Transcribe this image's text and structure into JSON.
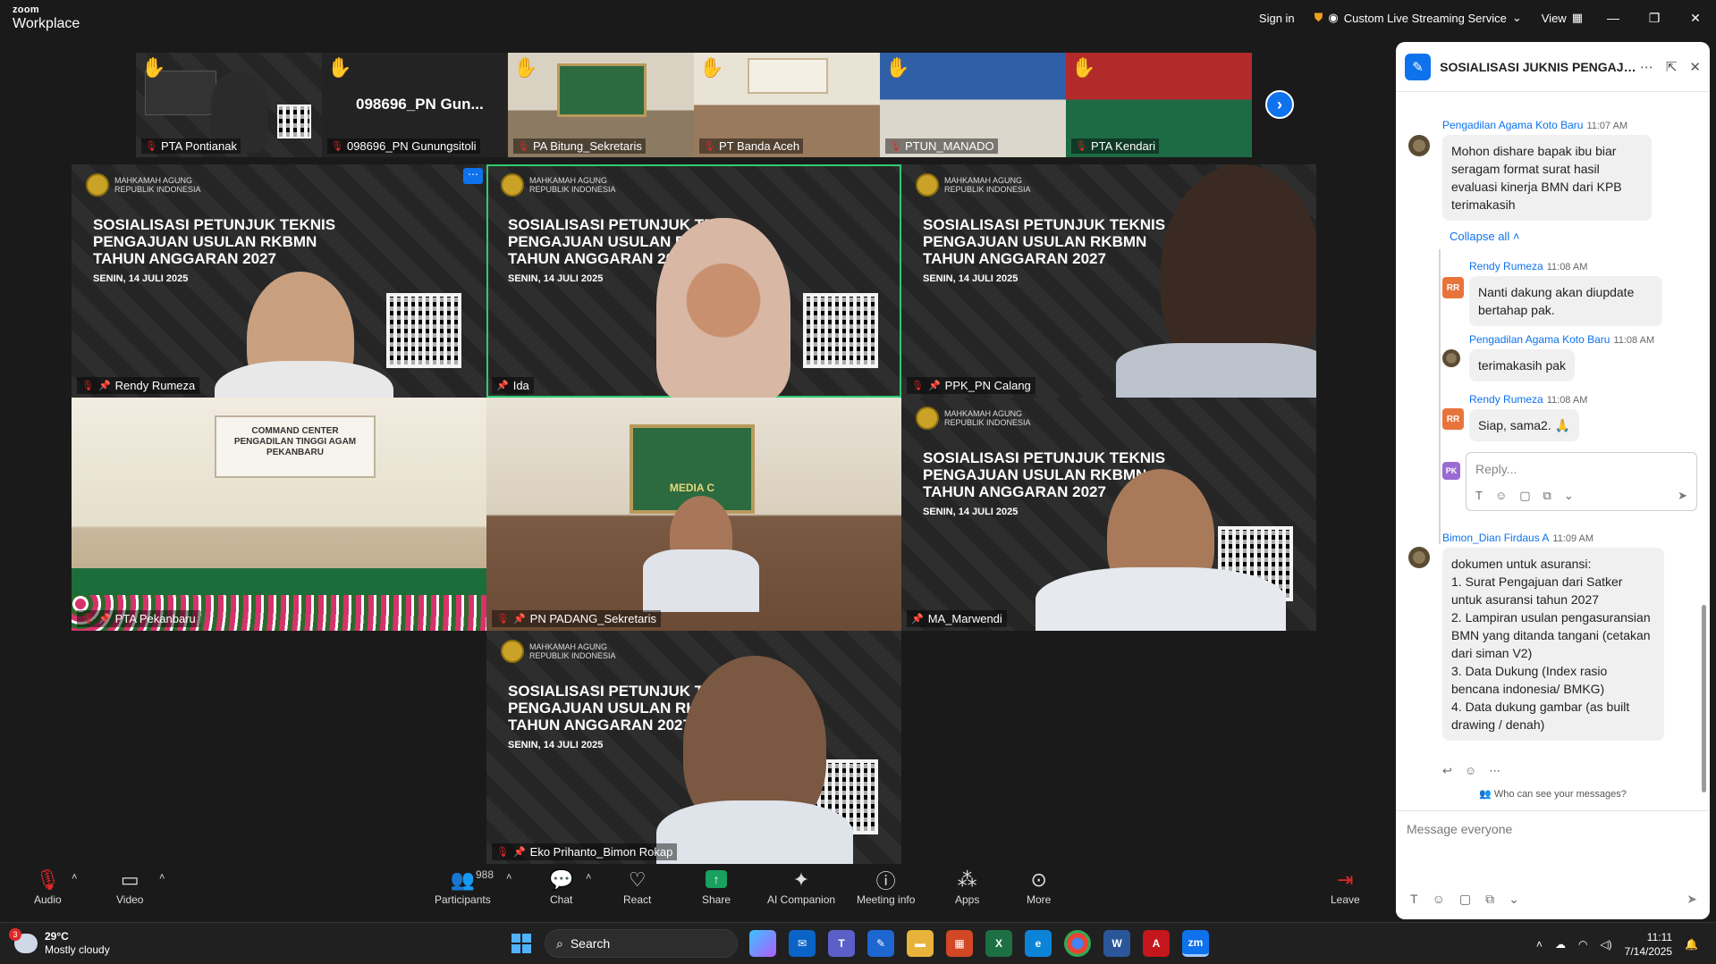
{
  "app": {
    "brand_small": "zoom",
    "brand_large": "Workplace"
  },
  "titlebar": {
    "sign_in": "Sign in",
    "stream": "Custom Live Streaming Service",
    "view": "View"
  },
  "strip": [
    {
      "label": "PTA Pontianak"
    },
    {
      "label": "098696_PN Gunungsitoli",
      "display_name": "098696_PN Gun..."
    },
    {
      "label": "PA Bitung_Sekretaris"
    },
    {
      "label": "PT Banda Aceh"
    },
    {
      "label": "PTUN_MANADO"
    },
    {
      "label": "PTA Kendari"
    }
  ],
  "slide": {
    "org_line1": "MAHKAMAH AGUNG",
    "org_line2": "REPUBLIK INDONESIA",
    "title_line1": "SOSIALISASI PETUNJUK TEKNIS",
    "title_line2": "PENGAJUAN USULAN RKBMN",
    "title_line3": "TAHUN ANGGARAN 2027",
    "title_line1_cut": "SOSIALISASI PETUNJUK TEKN",
    "title_line2_cut": "PENGAJUAN USULAN RKBM",
    "title_line3_cut": "TAHUN ANGGARAN 20",
    "date": "SENIN, 14 JULI 2025",
    "room1_banner1": "COMMAND CENTER",
    "room1_banner2": "PENGADILAN TINGGI AGAM",
    "room1_banner3": "PEKANBARU",
    "room2_banner": "MEDIA C"
  },
  "tiles": [
    {
      "name": "Rendy Rumeza"
    },
    {
      "name": "Ida"
    },
    {
      "name": "PPK_PN Calang"
    },
    {
      "name": "PTA Pekanbaru"
    },
    {
      "name": "PN PADANG_Sekretaris"
    },
    {
      "name": "MA_Marwendi"
    },
    {
      "name": "Eko Prihanto_Bimon Rokap"
    }
  ],
  "chat": {
    "title": "SOSIALISASI JUKNIS PENGAJUA...",
    "messages": [
      {
        "sender": "Pengadilan Agama Koto Baru",
        "time": "11:07 AM",
        "text": "Mohon dishare bapak ibu biar seragam format surat hasil evaluasi kinerja BMN dari KPB terimakasih"
      },
      {
        "sender": "Rendy Rumeza",
        "time": "11:08 AM",
        "initials": "RR",
        "text": "Nanti dakung akan diupdate bertahap pak."
      },
      {
        "sender": "Pengadilan Agama Koto Baru",
        "time": "11:08 AM",
        "text": "terimakasih pak"
      },
      {
        "sender": "Rendy Rumeza",
        "time": "11:08 AM",
        "initials": "RR",
        "text": "Siap, sama2. 🙏"
      },
      {
        "sender": "Bimon_Dian Firdaus A",
        "time": "11:09 AM",
        "lines": [
          "dokumen untuk asuransi:",
          "1. Surat Pengajuan dari Satker untuk asuransi tahun 2027",
          "2. Lampiran usulan pengasuransian BMN yang ditanda tangani (cetakan dari siman V2)",
          "3. Data Dukung (Index rasio bencana indonesia/ BMKG)",
          "4. Data dukung gambar (as built drawing / denah)"
        ]
      }
    ],
    "collapse_all": "Collapse all",
    "reply_placeholder": "Reply...",
    "reply_avatar": "PK",
    "who_can_see": "Who can see your messages?",
    "message_placeholder": "Message everyone"
  },
  "toolbar": {
    "audio": "Audio",
    "video": "Video",
    "participants": "Participants",
    "participants_count": "988",
    "chat": "Chat",
    "react": "React",
    "share": "Share",
    "ai": "AI Companion",
    "meeting_info": "Meeting info",
    "apps": "Apps",
    "more": "More",
    "leave": "Leave"
  },
  "taskbar": {
    "weather_badge": "3",
    "temp": "29°C",
    "condition": "Mostly cloudy",
    "search": "Search",
    "time": "11:11",
    "date": "7/14/2025"
  },
  "colors": {
    "accent": "#0e72ed",
    "active_tile": "#2ecc71",
    "muted": "#e02828",
    "share": "#19a15f"
  }
}
